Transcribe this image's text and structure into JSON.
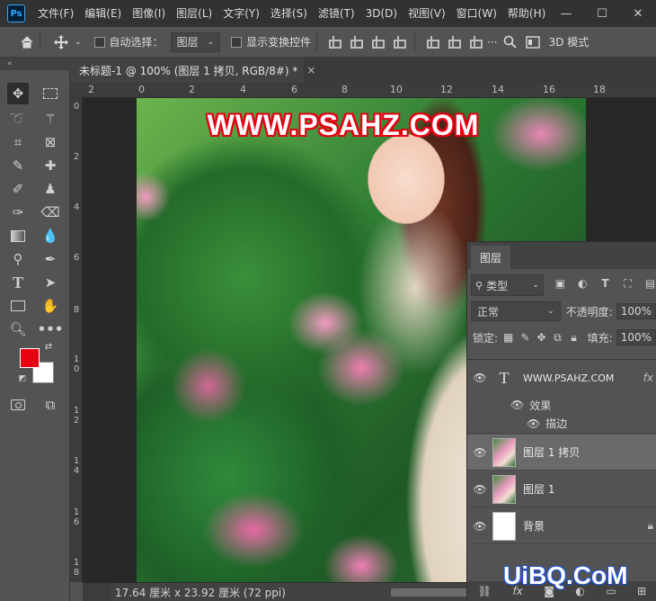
{
  "app": {
    "logo": "Ps"
  },
  "menu": [
    "文件(F)",
    "编辑(E)",
    "图像(I)",
    "图层(L)",
    "文字(Y)",
    "选择(S)",
    "滤镜(T)",
    "3D(D)",
    "视图(V)",
    "窗口(W)",
    "帮助(H)"
  ],
  "window_controls": {
    "minimize": "—",
    "restore": "☐",
    "close": "✕"
  },
  "options": {
    "auto_select_label": "自动选择：",
    "auto_select_value": "图层",
    "show_transform_label": "显示变换控件",
    "mode_3d_label": "3D 模式"
  },
  "toolbox": {
    "collapse": "«"
  },
  "document": {
    "tab_title": "未标题-1 @ 100% (图层 1 拷贝, RGB/8#) *",
    "tab_close": "×",
    "status": "17.64 厘米 x 23.92 厘米 (72 ppi)"
  },
  "ruler_top": [
    "2",
    "0",
    "2",
    "4",
    "6",
    "8",
    "10",
    "12",
    "14",
    "16",
    "18"
  ],
  "ruler_left": [
    "0",
    "2",
    "4",
    "6",
    "8",
    "1\n0",
    "1\n2",
    "1\n4",
    "1\n6",
    "1\n8"
  ],
  "canvas": {
    "watermark_text": "WWW.PSAHZ.COM"
  },
  "layers_panel": {
    "tab": "图层",
    "filter_kind": "类型",
    "blend_mode": "正常",
    "opacity_label": "不透明度:",
    "opacity_value": "100%",
    "lock_label": "锁定:",
    "fill_label": "填充:",
    "fill_value": "100%",
    "layers": [
      {
        "name": "WWW.PSAHZ.COM",
        "type": "text",
        "effects_label": "效果",
        "effect_item": "描边",
        "fx": "fx"
      },
      {
        "name": "图层 1 拷贝",
        "type": "image",
        "selected": true
      },
      {
        "name": "图层 1",
        "type": "image"
      },
      {
        "name": "背景",
        "type": "background"
      }
    ]
  },
  "site_watermark": "UiBQ.CoM",
  "colors": {
    "foreground": "#e60012",
    "background": "#ffffff",
    "accent": "#31a8ff"
  }
}
